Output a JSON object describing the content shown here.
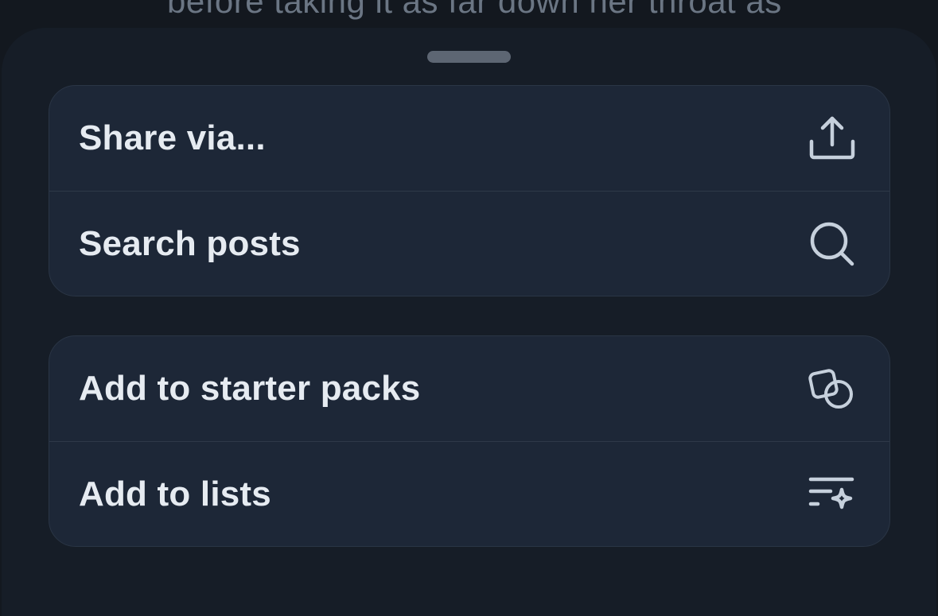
{
  "backdrop": {
    "text": "before taking it as far down her throat as"
  },
  "sheet": {
    "groups": [
      {
        "items": [
          {
            "label": "Share via...",
            "icon": "share-icon"
          },
          {
            "label": "Search posts",
            "icon": "search-icon"
          }
        ]
      },
      {
        "items": [
          {
            "label": "Add to starter packs",
            "icon": "starter-pack-icon"
          },
          {
            "label": "Add to lists",
            "icon": "list-sparkle-icon"
          }
        ]
      }
    ]
  },
  "colors": {
    "background": "#13181f",
    "sheet": "#161d27",
    "card": "#1d2737",
    "text": "#e6ebf1",
    "icon": "#c6d0dc"
  }
}
